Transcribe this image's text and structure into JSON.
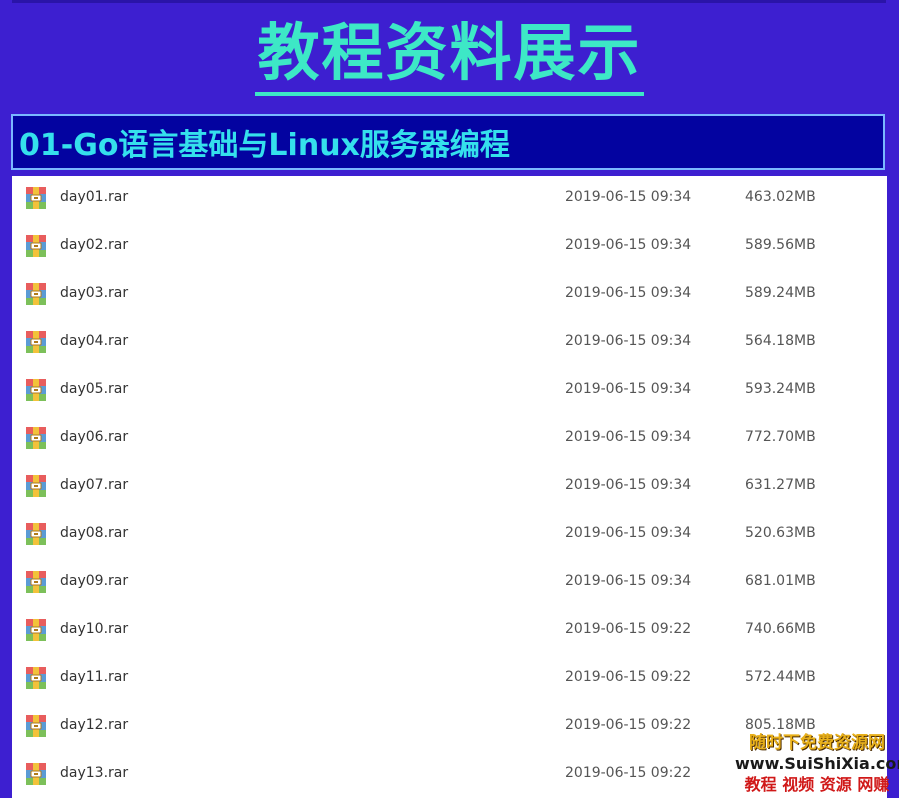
{
  "hero": {
    "title": "教程资料展示"
  },
  "section": {
    "title": "01-Go语言基础与Linux服务器编程"
  },
  "files": [
    {
      "name": "day01.rar",
      "date": "2019-06-15 09:34",
      "size": "463.02MB"
    },
    {
      "name": "day02.rar",
      "date": "2019-06-15 09:34",
      "size": "589.56MB"
    },
    {
      "name": "day03.rar",
      "date": "2019-06-15 09:34",
      "size": "589.24MB"
    },
    {
      "name": "day04.rar",
      "date": "2019-06-15 09:34",
      "size": "564.18MB"
    },
    {
      "name": "day05.rar",
      "date": "2019-06-15 09:34",
      "size": "593.24MB"
    },
    {
      "name": "day06.rar",
      "date": "2019-06-15 09:34",
      "size": "772.70MB"
    },
    {
      "name": "day07.rar",
      "date": "2019-06-15 09:34",
      "size": "631.27MB"
    },
    {
      "name": "day08.rar",
      "date": "2019-06-15 09:34",
      "size": "520.63MB"
    },
    {
      "name": "day09.rar",
      "date": "2019-06-15 09:34",
      "size": "681.01MB"
    },
    {
      "name": "day10.rar",
      "date": "2019-06-15 09:22",
      "size": "740.66MB"
    },
    {
      "name": "day11.rar",
      "date": "2019-06-15 09:22",
      "size": "572.44MB"
    },
    {
      "name": "day12.rar",
      "date": "2019-06-15 09:22",
      "size": "805.18MB"
    },
    {
      "name": "day13.rar",
      "date": "2019-06-15 09:22",
      "size": ""
    }
  ],
  "file_icon": "winrar-archive-icon",
  "watermark": {
    "line1": "随时下免费资源网",
    "line2": "www.SuiShiXia.com",
    "line3": "教程 视频 资源 网赚"
  },
  "colors": {
    "background": "#3d1fd0",
    "hero_title": "#3de8c6",
    "banner_bg": "#0303a0",
    "banner_text": "#35e0ec"
  }
}
